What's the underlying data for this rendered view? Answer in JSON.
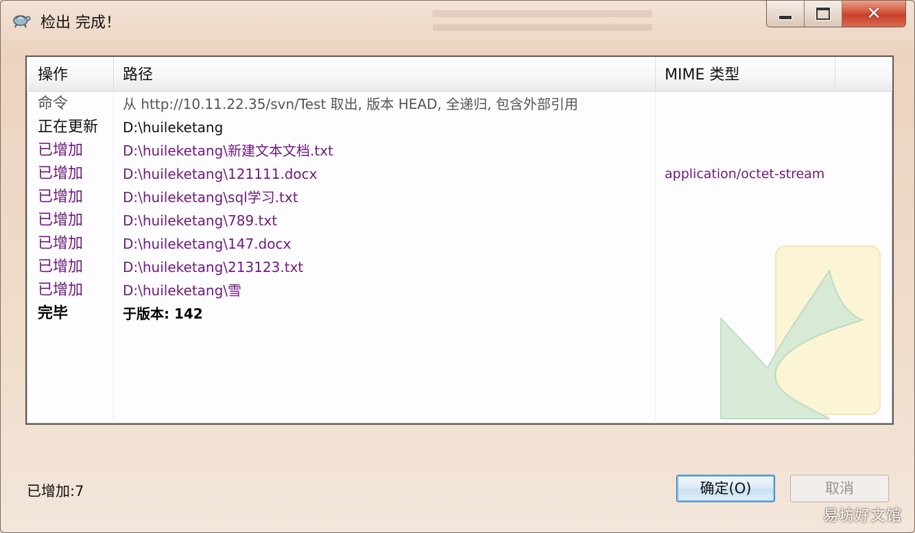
{
  "window": {
    "title": "检出 完成！",
    "close_glyph": "✕",
    "min_glyph_name": "minimize-icon",
    "max_glyph_name": "maximize-icon"
  },
  "list": {
    "headers": {
      "action": "操作",
      "path": "路径",
      "mime": "MIME 类型"
    },
    "rows": [
      {
        "action": "命令",
        "path": "从 http://10.11.22.35/svn/Test 取出, 版本 HEAD, 全递归, 包含外部引用",
        "mime": "",
        "kind": "cmd"
      },
      {
        "action": "正在更新",
        "path": "D:\\huileketang",
        "mime": "",
        "kind": "upd"
      },
      {
        "action": "已增加",
        "path": "D:\\huileketang\\新建文本文档.txt",
        "mime": "",
        "kind": "add"
      },
      {
        "action": "已增加",
        "path": "D:\\huileketang\\121111.docx",
        "mime": "application/octet-stream",
        "kind": "add"
      },
      {
        "action": "已增加",
        "path": "D:\\huileketang\\sql学习.txt",
        "mime": "",
        "kind": "add"
      },
      {
        "action": "已增加",
        "path": "D:\\huileketang\\789.txt",
        "mime": "",
        "kind": "add"
      },
      {
        "action": "已增加",
        "path": "D:\\huileketang\\147.docx",
        "mime": "",
        "kind": "add"
      },
      {
        "action": "已增加",
        "path": "D:\\huileketang\\213123.txt",
        "mime": "",
        "kind": "add"
      },
      {
        "action": "已增加",
        "path": "D:\\huileketang\\雪",
        "mime": "",
        "kind": "add"
      },
      {
        "action": "完毕",
        "path": "于版本: 142",
        "mime": "",
        "kind": "done"
      }
    ]
  },
  "footer": {
    "status": "已增加:7",
    "ok_label": "确定(O)",
    "cancel_label": "取消"
  },
  "watermark_text": "易坊好文馆",
  "colors": {
    "added": "#6e1a7c",
    "command": "#555555",
    "ok_border": "#2f6ea6"
  }
}
